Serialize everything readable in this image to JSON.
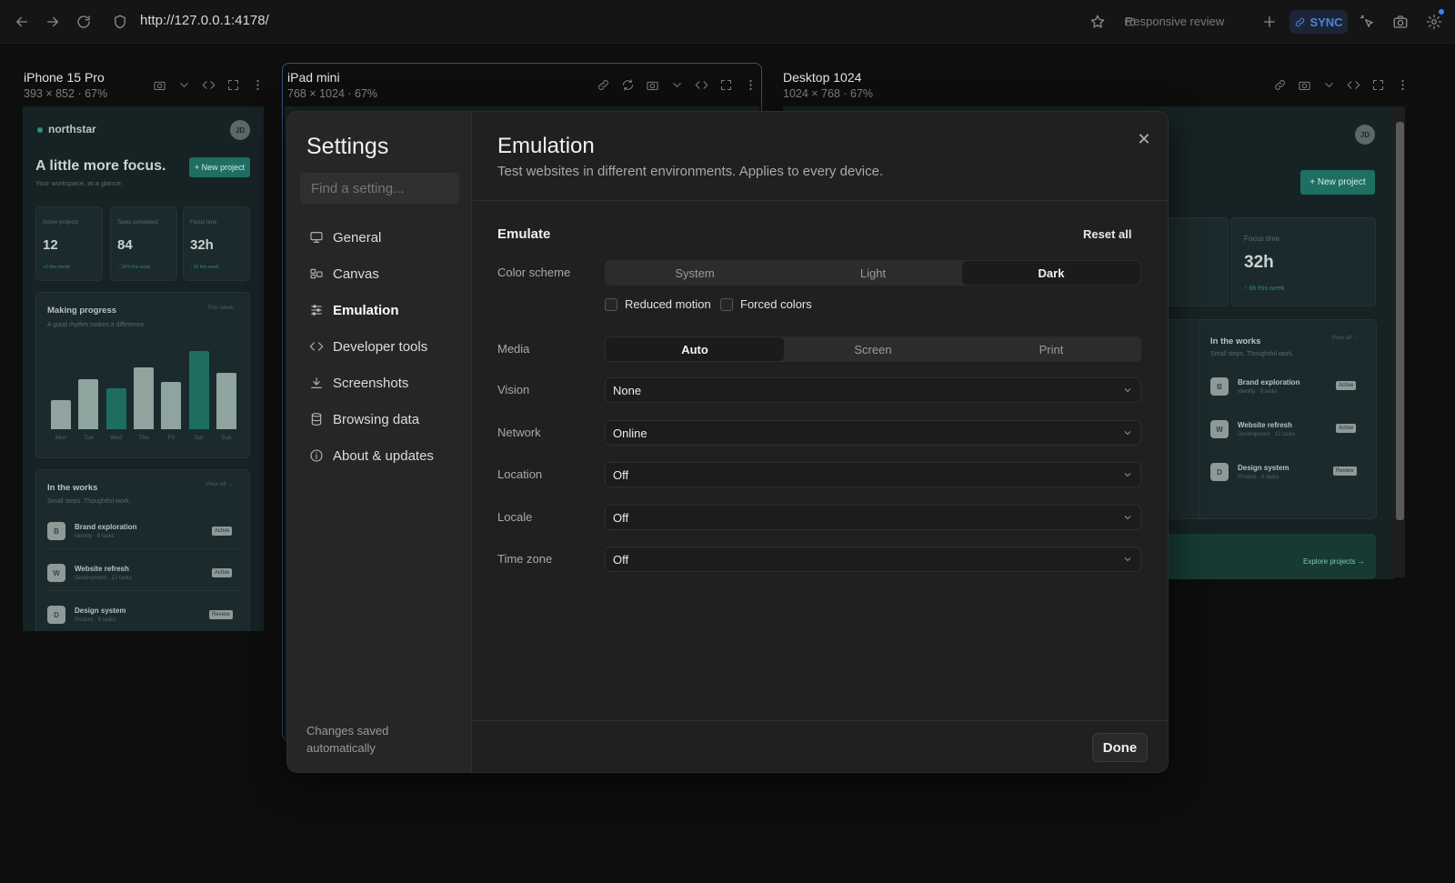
{
  "browser": {
    "url": "http://127.0.0.1:4178/",
    "responsive_review": "Responsive review",
    "sync": "SYNC"
  },
  "devices": [
    {
      "name": "iPhone 15 Pro",
      "meta": "393 × 852 · 67%"
    },
    {
      "name": "iPad mini",
      "meta": "768 × 1024 · 67%"
    },
    {
      "name": "Desktop 1024",
      "meta": "1024 × 768 · 67%"
    }
  ],
  "app": {
    "logo": "northstar",
    "avatar": "JD",
    "headline": "A little more focus.",
    "subhead": "Your workspace, at a glance.",
    "new_project": "+ New project",
    "stats": [
      {
        "label": "Active projects",
        "value": "12",
        "delta": "+2 this month"
      },
      {
        "label": "Tasks completed",
        "value": "84",
        "delta": "↑ 18% this week"
      },
      {
        "label": "Focus time",
        "value": "32h",
        "delta": "↑ 6h this week"
      }
    ],
    "progress": {
      "title": "Making progress",
      "subtitle": "A good rhythm makes a difference.",
      "range": "This week"
    },
    "works": {
      "title": "In the works",
      "subtitle": "Small steps. Thoughtful work.",
      "view_all": "View all →",
      "items": [
        {
          "initial": "B",
          "title": "Brand exploration",
          "meta": "Identity · 8 tasks",
          "status": "Active"
        },
        {
          "initial": "W",
          "title": "Website refresh",
          "meta": "Development · 12 tasks",
          "status": "Active"
        },
        {
          "initial": "D",
          "title": "Design system",
          "meta": "Product · 6 tasks",
          "status": "Review"
        }
      ]
    },
    "explore": "Explore projects →"
  },
  "chart_data": {
    "type": "bar",
    "categories": [
      "Mon",
      "Tue",
      "Wed",
      "Thu",
      "Fri",
      "Sat",
      "Sun"
    ],
    "values": [
      32,
      54,
      44,
      67,
      51,
      85,
      61
    ],
    "highlight": [
      "Wed",
      "Sat"
    ],
    "colors": {
      "normal": "#8fa39f",
      "highlight": "#1e6e60"
    }
  },
  "settings": {
    "title": "Settings",
    "search_placeholder": "Find a setting...",
    "nav": [
      {
        "label": "General",
        "icon": "monitor-icon"
      },
      {
        "label": "Canvas",
        "icon": "layout-icon"
      },
      {
        "label": "Emulation",
        "icon": "sliders-icon",
        "active": true
      },
      {
        "label": "Developer tools",
        "icon": "code-icon"
      },
      {
        "label": "Screenshots",
        "icon": "download-icon"
      },
      {
        "label": "Browsing data",
        "icon": "database-icon"
      },
      {
        "label": "About & updates",
        "icon": "info-icon"
      }
    ],
    "footer_note": "Changes saved automatically",
    "page_title": "Emulation",
    "page_subtitle": "Test websites in different environments. Applies to every device.",
    "section": "Emulate",
    "reset": "Reset all",
    "color_scheme": {
      "label": "Color scheme",
      "options": [
        "System",
        "Light",
        "Dark"
      ],
      "selected": "Dark"
    },
    "reduced_motion": "Reduced motion",
    "forced_colors": "Forced colors",
    "media": {
      "label": "Media",
      "options": [
        "Auto",
        "Screen",
        "Print"
      ],
      "selected": "Auto"
    },
    "vision": {
      "label": "Vision",
      "value": "None"
    },
    "network": {
      "label": "Network",
      "value": "Online"
    },
    "location": {
      "label": "Location",
      "value": "Off"
    },
    "locale": {
      "label": "Locale",
      "value": "Off"
    },
    "timezone": {
      "label": "Time zone",
      "value": "Off"
    },
    "done": "Done"
  }
}
